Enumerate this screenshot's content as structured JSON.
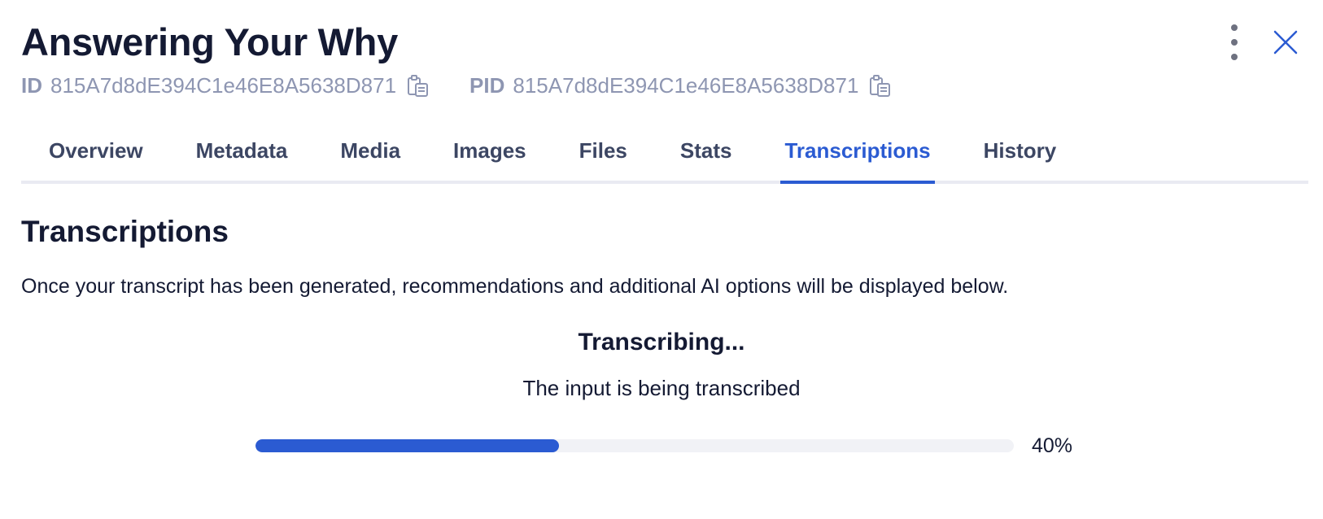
{
  "header": {
    "title": "Answering Your Why",
    "menu_icon": "more-vertical-icon",
    "close_icon": "close-icon"
  },
  "ids": {
    "id_label": "ID",
    "id_value": "815A7d8dE394C1e46E8A5638D871",
    "pid_label": "PID",
    "pid_value": "815A7d8dE394C1e46E8A5638D871",
    "copy_icon": "clipboard-copy-icon"
  },
  "tabs": [
    {
      "label": "Overview",
      "active": false
    },
    {
      "label": "Metadata",
      "active": false
    },
    {
      "label": "Media",
      "active": false
    },
    {
      "label": "Images",
      "active": false
    },
    {
      "label": "Files",
      "active": false
    },
    {
      "label": "Stats",
      "active": false
    },
    {
      "label": "Transcriptions",
      "active": true
    },
    {
      "label": "History",
      "active": false
    }
  ],
  "section": {
    "title": "Transcriptions",
    "description": "Once your transcript has been generated, recommendations and additional AI options will be displayed below."
  },
  "status": {
    "title": "Transcribing...",
    "subtitle": "The input is being transcribed",
    "progress_percent": 40,
    "progress_label": "40%"
  },
  "colors": {
    "accent": "#2b5bd2",
    "text": "#141a33",
    "muted": "#8e96b2",
    "track": "#f1f2f6"
  }
}
